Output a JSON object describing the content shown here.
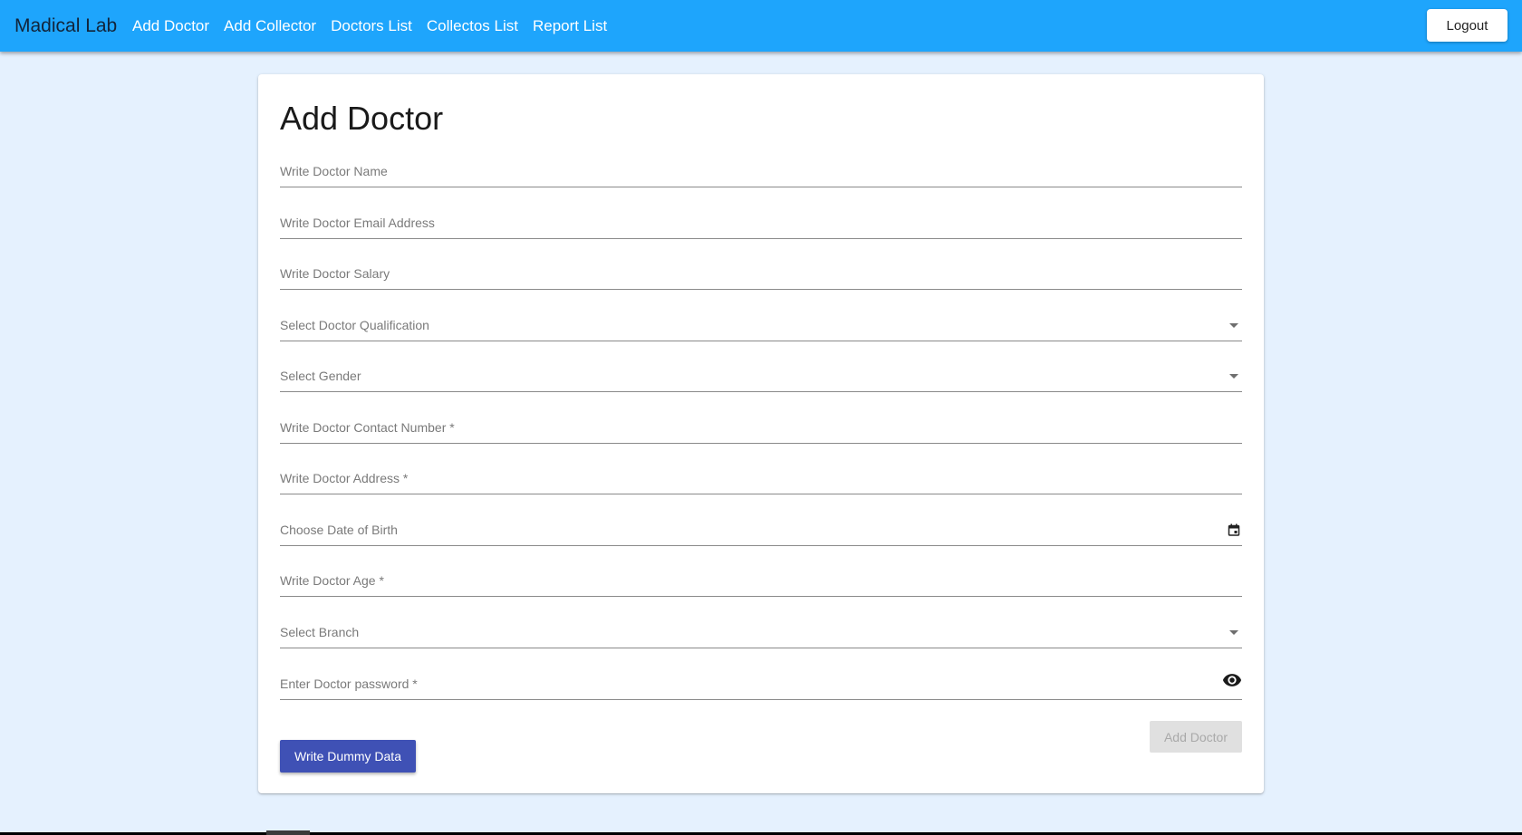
{
  "navbar": {
    "brand": "Madical Lab",
    "links": [
      {
        "label": "Add Doctor"
      },
      {
        "label": "Add Collector"
      },
      {
        "label": "Doctors List"
      },
      {
        "label": "Collectos List"
      },
      {
        "label": "Report List"
      }
    ],
    "logout_label": "Logout",
    "background_color": "#1ea5fc"
  },
  "page": {
    "background_color": "#e5f1fe",
    "title": "Add Doctor"
  },
  "form": {
    "doctor_name": {
      "placeholder": "Write Doctor Name",
      "value": ""
    },
    "doctor_email": {
      "placeholder": "Write Doctor Email Address",
      "value": ""
    },
    "doctor_salary": {
      "placeholder": "Write Doctor Salary",
      "value": ""
    },
    "qualification": {
      "placeholder": "Select Doctor Qualification",
      "icon": "chevron-down-icon"
    },
    "gender": {
      "placeholder": "Select Gender",
      "icon": "chevron-down-icon"
    },
    "contact_number": {
      "placeholder": "Write Doctor Contact Number *",
      "value": ""
    },
    "address": {
      "placeholder": "Write Doctor Address *",
      "value": ""
    },
    "date_of_birth": {
      "placeholder": "Choose Date of Birth",
      "icon": "calendar-icon"
    },
    "age": {
      "placeholder": "Write Doctor Age *",
      "value": ""
    },
    "branch": {
      "placeholder": "Select Branch",
      "icon": "chevron-down-icon"
    },
    "password": {
      "placeholder": "Enter Doctor password *",
      "value": "",
      "icon": "eye-icon"
    }
  },
  "buttons": {
    "dummy_label": "Write Dummy Data",
    "dummy_color": "#3f51b5",
    "submit_label": "Add Doctor",
    "submit_disabled": true
  }
}
